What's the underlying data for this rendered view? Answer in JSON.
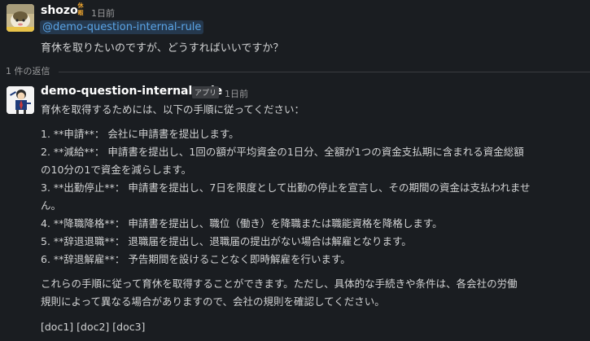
{
  "message1": {
    "user_name": "shozo",
    "status_emoji": "icon-status-on-leave",
    "status_text": [
      "休",
      "暇",
      "中"
    ],
    "timestamp": "1日前",
    "mention": "@demo-question-internal-rule",
    "text": "育休を取りたいのですが、どうすればいいですか？"
  },
  "thread": {
    "reply_count": "1 件の返信"
  },
  "message2": {
    "user_name": "demo-question-internal-rule",
    "badge": "アプリ",
    "timestamp": "1日前",
    "intro": "育休を取得するためには、以下の手順に従ってください：",
    "steps": [
      "1. **申請**： 会社に申請書を提出します。",
      "2. **減給**： 申請書を提出し、1回の額が平均資金の1日分、全額が1つの資金支払期に含まれる資金総額",
      "の10分の1で資金を減らします。",
      "3. **出勤停止**： 申請書を提出し、7日を限度として出勤の停止を宣言し、その期間の資金は支払われませ",
      "ん。",
      "4. **降職降格**： 申請書を提出し、職位（働き）を降職または職能資格を降格します。",
      "5. **辞退退職**： 退職届を提出し、退職届の提出がない場合は解雇となります。",
      "6. **辞退解雇**： 予告期間を設けることなく即時解雇を行います。"
    ],
    "closing": [
      "これらの手順に従って育休を取得することができます。ただし、具体的な手続きや条件は、各会社の労働",
      "規則によって異なる場合がありますので、会社の規則を確認してください。"
    ],
    "references": "[doc1] [doc2] [doc3]"
  }
}
